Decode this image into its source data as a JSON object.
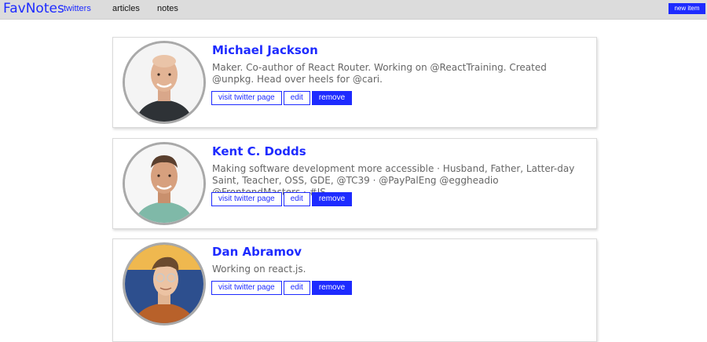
{
  "header": {
    "brand": "FavNotes",
    "nav": [
      {
        "label": "twitters",
        "active": true
      },
      {
        "label": "articles",
        "active": false
      },
      {
        "label": "notes",
        "active": false
      }
    ],
    "new_item_label": "new item"
  },
  "colors": {
    "accent": "#1e2bff",
    "topbar": "#dcdcdc",
    "description": "#666666"
  },
  "cards": [
    {
      "name": "Michael Jackson",
      "description": "Maker. Co-author of React Router. Working on @ReactTraining. Created @unpkg. Head over heels for @cari.",
      "buttons": {
        "visit": "visit twitter page",
        "edit": "edit",
        "remove": "remove"
      }
    },
    {
      "name": "Kent C. Dodds",
      "description": "Making software development more accessible · Husband, Father, Latter-day Saint, Teacher, OSS, GDE, @TC39 · @PayPalEng @eggheadio @FrontendMasters · #JS",
      "buttons": {
        "visit": "visit twitter page",
        "edit": "edit",
        "remove": "remove"
      }
    },
    {
      "name": "Dan Abramov",
      "description": "Working on react.js.",
      "buttons": {
        "visit": "visit twitter page",
        "edit": "edit",
        "remove": "remove"
      }
    }
  ]
}
